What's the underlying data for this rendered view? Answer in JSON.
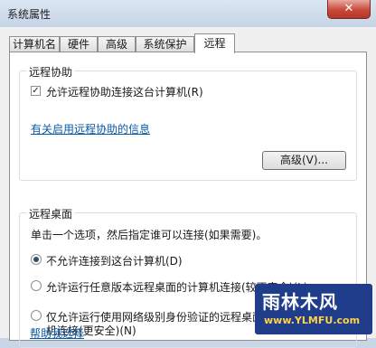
{
  "window": {
    "title": "系统属性",
    "close_glyph": "✕"
  },
  "tabs": [
    {
      "label": "计算机名"
    },
    {
      "label": "硬件"
    },
    {
      "label": "高级"
    },
    {
      "label": "系统保护"
    },
    {
      "label": "远程",
      "active": true
    }
  ],
  "remote_assistance": {
    "title": "远程协助",
    "allow_checkbox": {
      "label": "允许远程协助连接这台计算机(R)",
      "checked": true,
      "glyph": "✓"
    },
    "info_link": "有关启用远程协助的信息",
    "advanced_button": "高级(V)..."
  },
  "remote_desktop": {
    "title": "远程桌面",
    "instruction": "单击一个选项，然后指定谁可以连接(如果需要)。",
    "options": [
      {
        "label": "不允许连接到这台计算机(D)",
        "checked": true
      },
      {
        "label": "允许运行任意版本远程桌面的计算机连接(较不安全)(L)",
        "checked": false
      },
      {
        "label_line1": "仅允许运行使用网络级别身份验证的远程桌面的计算",
        "label_line2": "机连接(更安全)(N)",
        "checked": false
      }
    ],
    "help_link": "帮助我选择"
  },
  "watermark": {
    "text": "雨林木风",
    "url": "www.YLMFU.com"
  }
}
